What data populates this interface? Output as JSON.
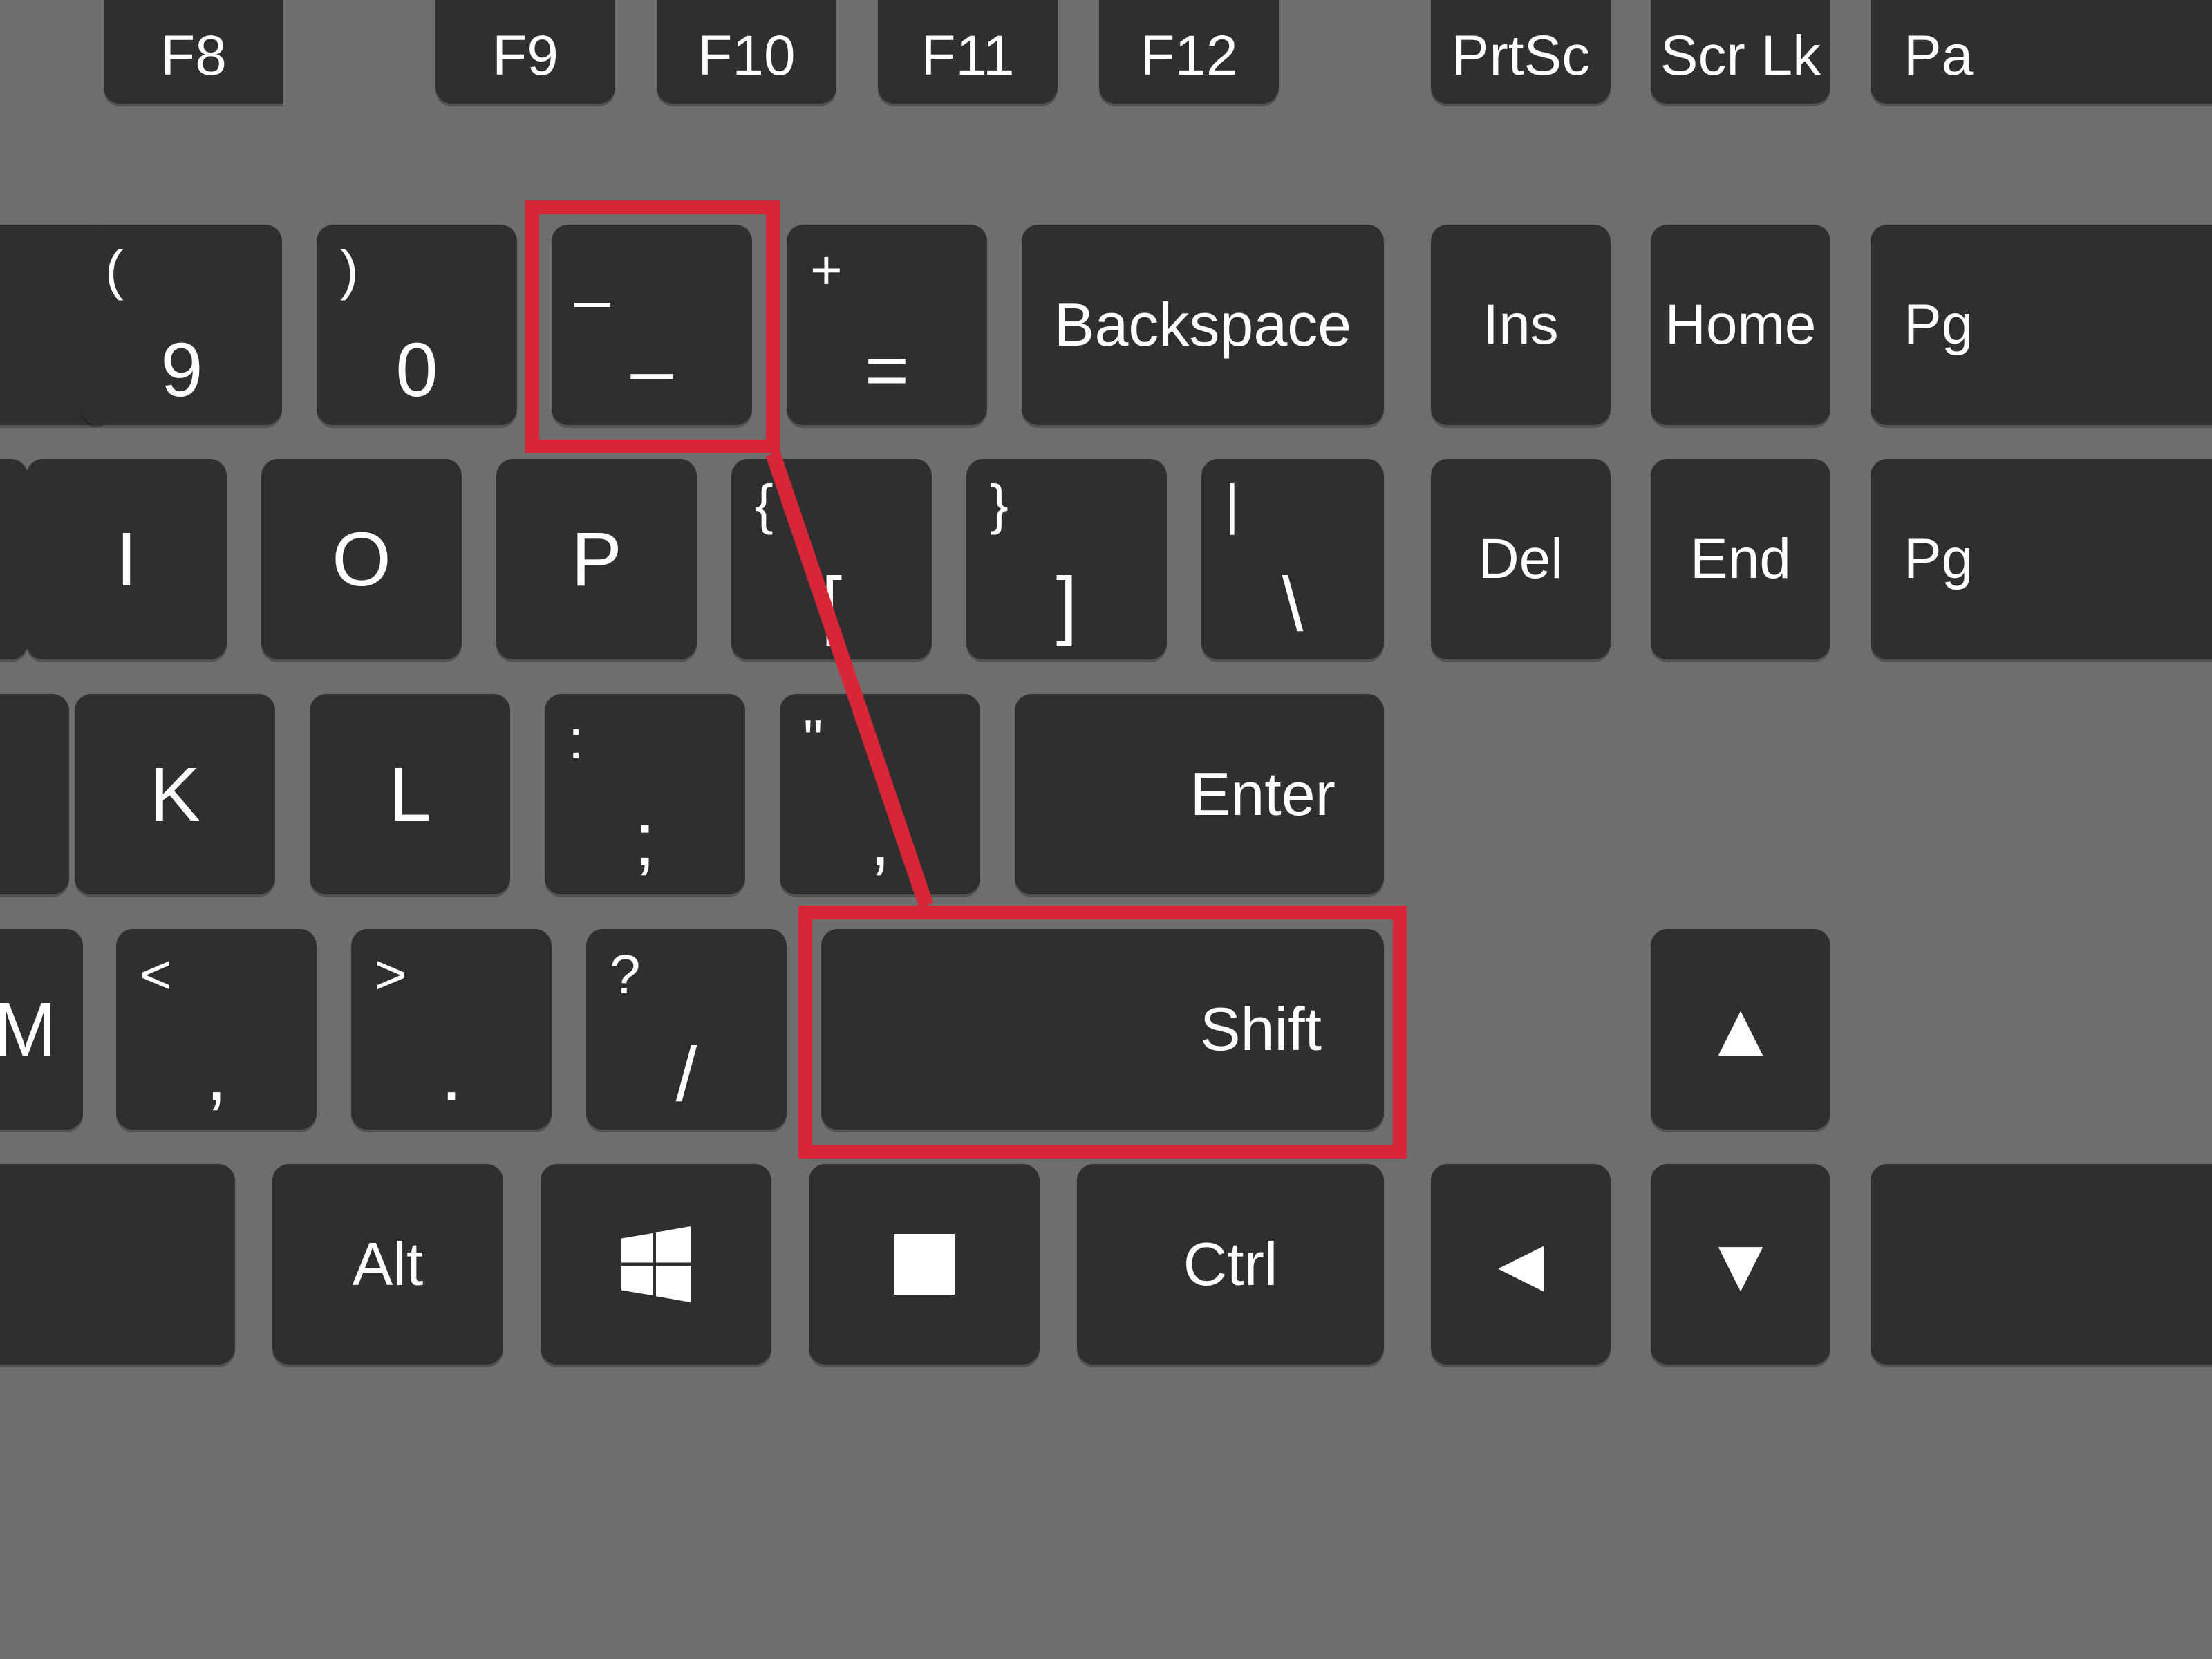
{
  "row_function": {
    "f8": "F8",
    "f9": "F9",
    "f10": "F10",
    "f11": "F11",
    "f12": "F12",
    "prtsc": "PrtSc",
    "scrlk": "Scr Lk",
    "pa": "Pa"
  },
  "row_number": {
    "nine_upper": "(",
    "nine_lower": "9",
    "zero_upper": ")",
    "zero_lower": "0",
    "minus_upper": "_",
    "minus_lower": "–",
    "equals_upper": "+",
    "equals_lower": "=",
    "backspace": "Backspace",
    "ins": "Ins",
    "home": "Home",
    "pg": "Pg"
  },
  "row_q": {
    "i": "I",
    "o": "O",
    "p": "P",
    "lbracket_upper": "{",
    "lbracket_lower": "[",
    "rbracket_upper": "}",
    "rbracket_lower": "]",
    "backslash_upper": "|",
    "backslash_lower": "\\",
    "del": "Del",
    "end": "End",
    "pg2": "Pg"
  },
  "row_a": {
    "k": "K",
    "l": "L",
    "semicolon_upper": ":",
    "semicolon_lower": ";",
    "quote_upper": "\"",
    "quote_lower": ",",
    "enter": "Enter"
  },
  "row_z": {
    "m": "M",
    "comma_upper": "<",
    "comma_lower": ",",
    "period_upper": ">",
    "period_lower": ".",
    "slash_upper": "?",
    "slash_lower": "/",
    "shift": "Shift"
  },
  "row_bottom": {
    "alt": "Alt",
    "ctrl": "Ctrl"
  },
  "icons": {
    "windows": "windows-icon",
    "menu": "menu-icon",
    "arrow_up": "▲",
    "arrow_left": "◄",
    "arrow_down": "▼"
  },
  "highlight": {
    "color": "#d72638"
  }
}
